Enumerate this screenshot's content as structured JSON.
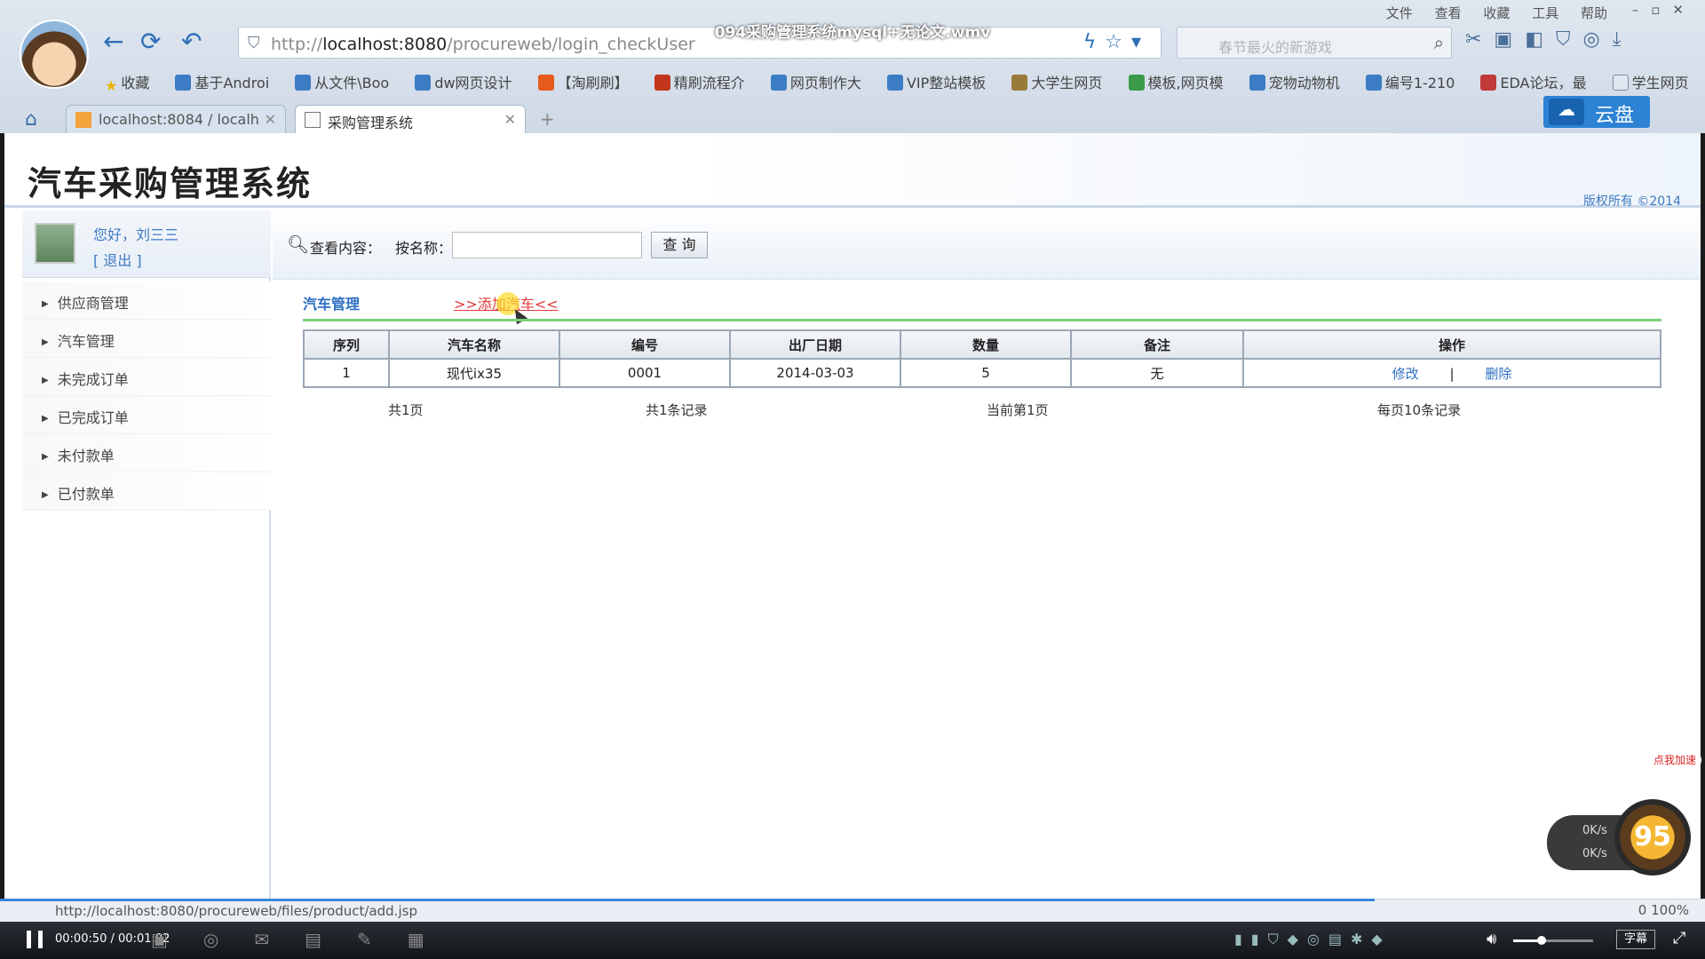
{
  "video": {
    "title": "094采购管理系统mysql+无论文.wmv",
    "time": "00:00:50 / 00:01:02",
    "subtitle_btn": "字幕",
    "progress_pct": 80.6
  },
  "browser": {
    "menu": [
      "文件",
      "查看",
      "收藏",
      "工具",
      "帮助"
    ],
    "address": {
      "prefix": "http://",
      "host": "localhost:8080",
      "path": "/procureweb/login_checkUser"
    },
    "search_placeholder": "春节最火的新游戏",
    "bookmarks": [
      "收藏",
      "基于Androi",
      "从文件\\Boo",
      "dw网页设计",
      "【淘刷刷】",
      "精刷流程介",
      "网页制作大",
      "VIP整站模板",
      "大学生网页",
      "模板,网页模",
      "宠物动物机",
      "编号1-210",
      "EDA论坛，最",
      "学生网页"
    ],
    "tabs": [
      {
        "label": "localhost:8084 / localh",
        "active": false
      },
      {
        "label": "采购管理系统",
        "active": true
      }
    ],
    "cloud_label": "云盘",
    "status_url": "http://localhost:8080/procureweb/files/product/add.jsp",
    "status_right": "0    100%",
    "zoom": "100%"
  },
  "site": {
    "title": "汽车采购管理系统",
    "copyright": "版权所有  ©2014",
    "user": {
      "greeting": "您好，刘三三",
      "logout": "[  退出  ]"
    },
    "menu": [
      "供应商管理",
      "汽车管理",
      "未完成订单",
      "已完成订单",
      "未付款单",
      "已付款单"
    ],
    "search": {
      "view_label": "查看内容：",
      "name_label": "按名称：",
      "name_value": "",
      "query_btn": "查 询"
    },
    "section": {
      "title": "汽车管理",
      "add_link": ">>添加汽车<<"
    },
    "table": {
      "headers": [
        "序列",
        "汽车名称",
        "编号",
        "出厂日期",
        "数量",
        "备注",
        "操作"
      ],
      "rows": [
        {
          "seq": "1",
          "name": "现代ix35",
          "code": "0001",
          "date": "2014-03-03",
          "qty": "5",
          "note": "无",
          "edit": "修改",
          "sep": "|",
          "delete": "删除"
        }
      ]
    },
    "pager": {
      "total_pages": "共1页",
      "total_records": "共1条记录",
      "current": "当前第1页",
      "per_page": "每页10条记录"
    }
  },
  "widget": {
    "speed_up": "0K/s",
    "speed_down": "0K/s",
    "score": "95",
    "tag": "点我加速"
  },
  "colors": {
    "accent": "#2d6fc4",
    "link_red": "#e23b3b",
    "rule_green": "#7ccf7c",
    "player_progress": "#3b86d8"
  }
}
